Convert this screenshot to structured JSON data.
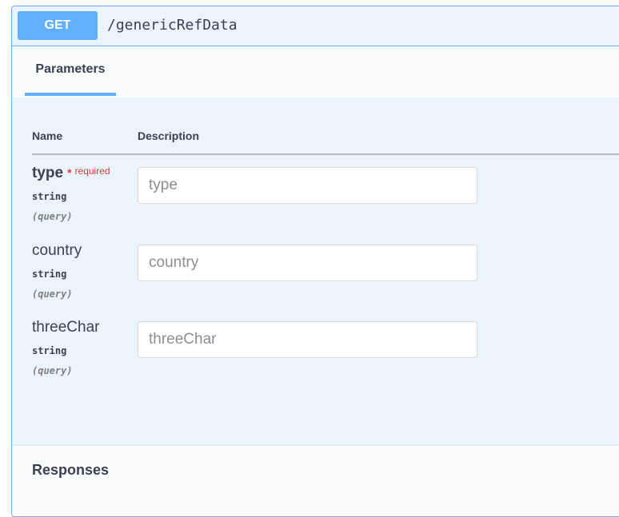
{
  "operation": {
    "method": "GET",
    "path": "/genericRefData"
  },
  "tabs": {
    "parameters_label": "Parameters"
  },
  "table": {
    "name_header": "Name",
    "description_header": "Description"
  },
  "parameters": [
    {
      "name": "type",
      "required_marker": "*",
      "required_label": "required",
      "type": "string",
      "in": "(query)",
      "placeholder": "type"
    },
    {
      "name": "country",
      "type": "string",
      "in": "(query)",
      "placeholder": "country"
    },
    {
      "name": "threeChar",
      "type": "string",
      "in": "(query)",
      "placeholder": "threeChar"
    }
  ],
  "responses": {
    "title": "Responses"
  },
  "colors": {
    "get_accent": "#61affe",
    "required": "#e53935",
    "text": "#3b4151"
  }
}
